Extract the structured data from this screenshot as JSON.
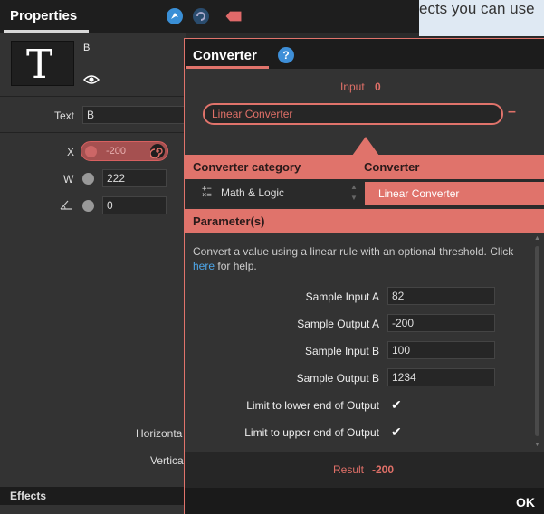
{
  "properties": {
    "title": "Properties",
    "layer_name": "B",
    "text_label": "Text",
    "text_value": "B",
    "x_label": "X",
    "x_value": "-200",
    "w_label": "W",
    "w_value": "222",
    "angle_value": "0",
    "horizontal_label": "Horizonta",
    "vertical_label": "Vertica",
    "effects_label": "Effects"
  },
  "canvas": {
    "visible_text": "ects you can use"
  },
  "converter": {
    "title": "Converter",
    "input_label": "Input",
    "input_value": "0",
    "selected_converter": "Linear Converter",
    "category_header": "Converter category",
    "converter_header": "Converter",
    "category_value": "Math & Logic",
    "converter_value": "Linear Converter",
    "parameters_header": "Parameter(s)",
    "description": "Convert a value using a linear rule with an optional threshold. Click",
    "help_link": "here",
    "description_tail": " for help.",
    "params": [
      {
        "label": "Sample Input A",
        "value": "82"
      },
      {
        "label": "Sample Output A",
        "value": "-200"
      },
      {
        "label": "Sample Input B",
        "value": "100"
      },
      {
        "label": "Sample Output B",
        "value": "1234"
      }
    ],
    "checks": [
      {
        "label": "Limit to lower end of Output",
        "checked": true
      },
      {
        "label": "Limit to upper end of Output",
        "checked": true
      }
    ],
    "result_label": "Result",
    "result_value": "-200",
    "ok_label": "OK"
  },
  "colors": {
    "accent": "#e0736b",
    "link": "#4ea6e8",
    "help": "#3e8fd8"
  }
}
